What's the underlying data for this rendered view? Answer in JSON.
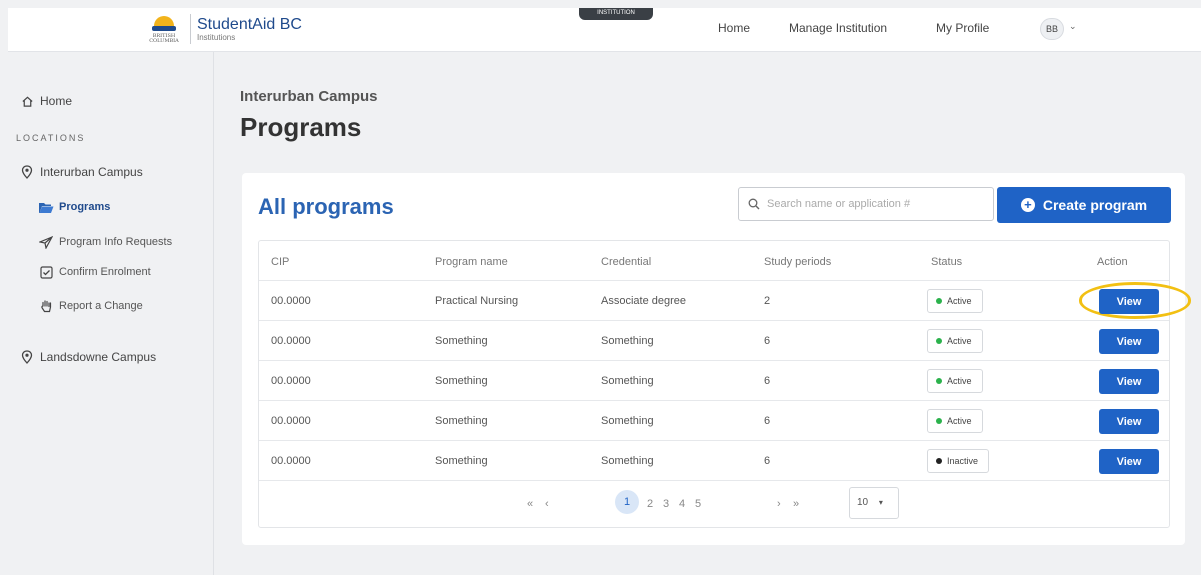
{
  "header": {
    "brand_title": "StudentAid BC",
    "brand_subtitle": "Institutions",
    "logo_text": "BRITISH COLUMBIA",
    "env_badge": "INSTITUTION",
    "nav": [
      "Home",
      "Manage Institution",
      "My Profile"
    ],
    "avatar_initials": "BB"
  },
  "sidebar": {
    "home_label": "Home",
    "locations_label": "LOCATIONS",
    "campus_1": "Interurban Campus",
    "items": [
      "Programs",
      "Program Info Requests",
      "Confirm Enrolment",
      "Report a Change"
    ],
    "campus_2": "Landsdowne Campus"
  },
  "main": {
    "breadcrumb": "Interurban Campus",
    "page_title": "Programs",
    "card_title": "All programs",
    "search_placeholder": "Search name or application #",
    "create_button": "Create program"
  },
  "table": {
    "headers": [
      "CIP",
      "Program name",
      "Credential",
      "Study periods",
      "Status",
      "Action"
    ],
    "rows": [
      {
        "cip": "00.0000",
        "name": "Practical Nursing",
        "credential": "Associate degree",
        "periods": "2",
        "status": "Active",
        "action": "View"
      },
      {
        "cip": "00.0000",
        "name": "Something",
        "credential": "Something",
        "periods": "6",
        "status": "Active",
        "action": "View"
      },
      {
        "cip": "00.0000",
        "name": "Something",
        "credential": "Something",
        "periods": "6",
        "status": "Active",
        "action": "View"
      },
      {
        "cip": "00.0000",
        "name": "Something",
        "credential": "Something",
        "periods": "6",
        "status": "Active",
        "action": "View"
      },
      {
        "cip": "00.0000",
        "name": "Something",
        "credential": "Something",
        "periods": "6",
        "status": "Inactive",
        "action": "View"
      }
    ]
  },
  "pagination": {
    "first": "«",
    "prev": "‹",
    "pages": [
      "1",
      "2",
      "3",
      "4",
      "5"
    ],
    "next": "›",
    "last": "»",
    "per_page": "10"
  },
  "colors": {
    "primary": "#1f63c6",
    "title_blue": "#2b64b3",
    "active_dot": "#2bb24c",
    "inactive_dot": "#222222",
    "highlight": "#f2c013"
  }
}
